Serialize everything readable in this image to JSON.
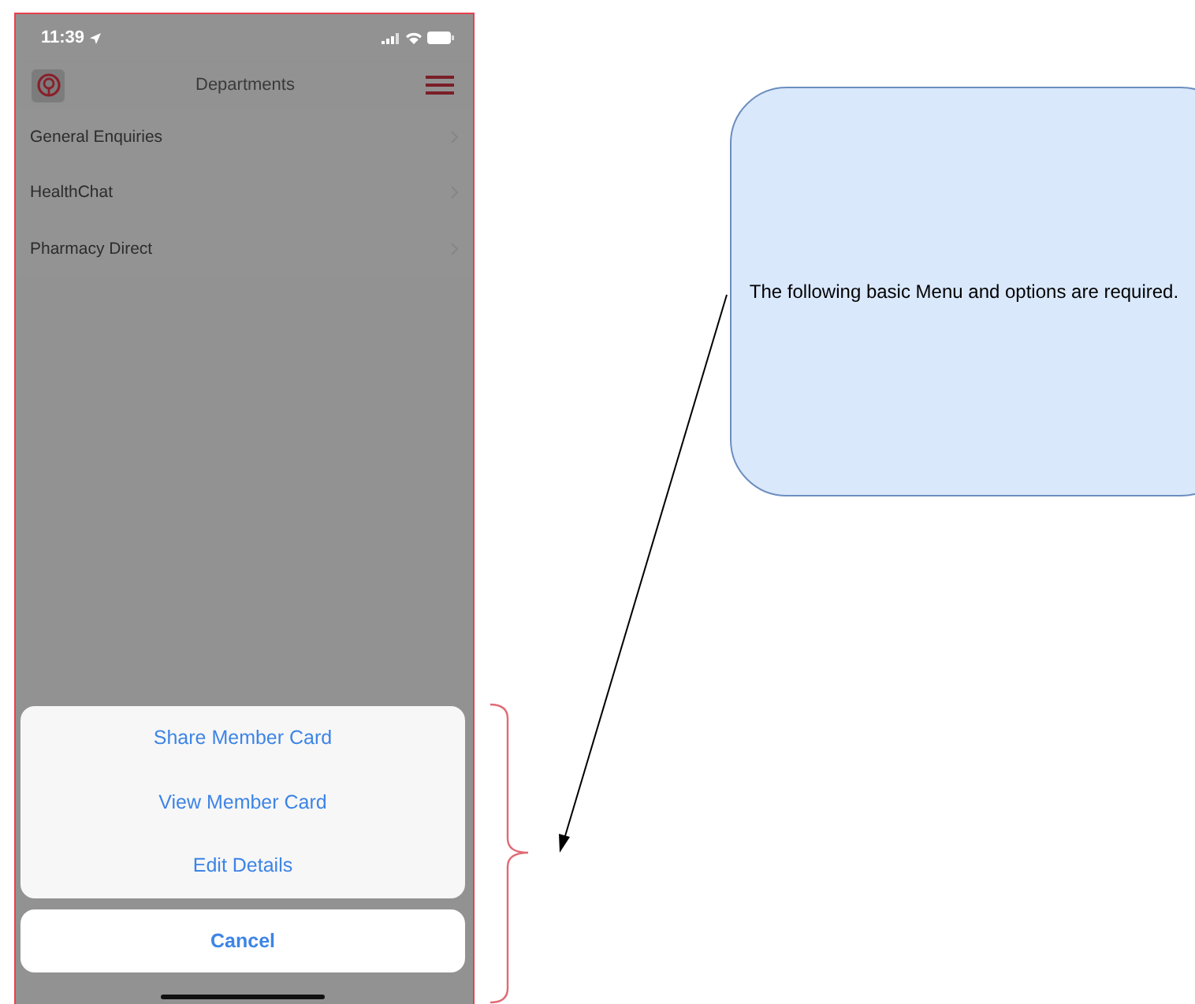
{
  "phone": {
    "status_bar": {
      "time": "11:39"
    },
    "nav_bar": {
      "title": "Departments"
    },
    "departments": [
      {
        "label": "General Enquiries"
      },
      {
        "label": "HealthChat"
      },
      {
        "label": "Pharmacy Direct"
      }
    ],
    "action_sheet": {
      "actions": [
        "Share Member Card",
        "View Member Card",
        "Edit Details"
      ],
      "cancel": "Cancel"
    }
  },
  "note": {
    "text": "The following basic Menu and options are required."
  }
}
